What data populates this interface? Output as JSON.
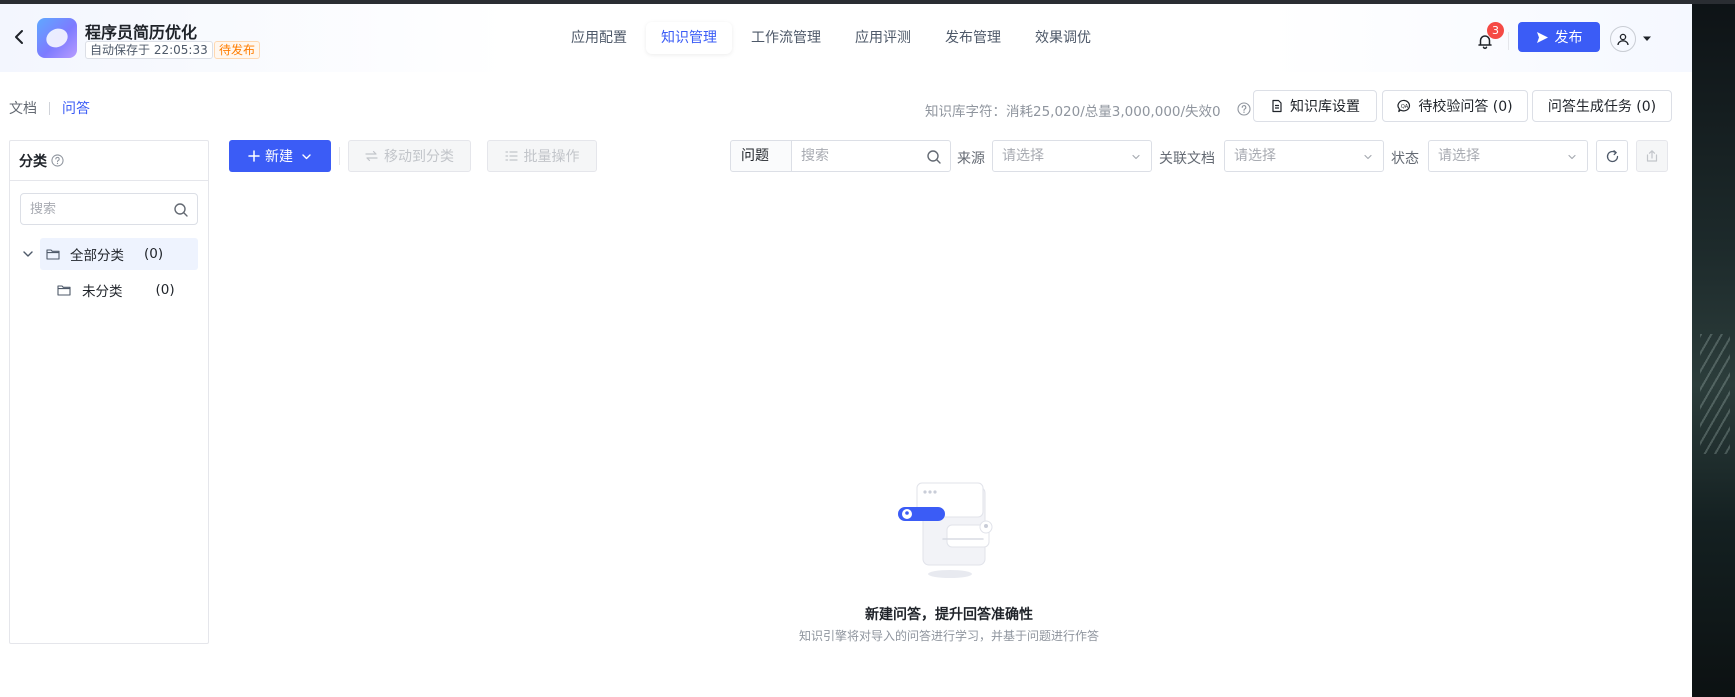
{
  "app": {
    "title": "程序员简历优化",
    "autosave": "自动保存于 22:05:33",
    "status": "待发布"
  },
  "nav": {
    "tabs": [
      {
        "label": "应用配置",
        "active": false
      },
      {
        "label": "知识管理",
        "active": true
      },
      {
        "label": "工作流管理",
        "active": false
      },
      {
        "label": "应用评测",
        "active": false
      },
      {
        "label": "发布管理",
        "active": false
      },
      {
        "label": "效果调优",
        "active": false
      }
    ]
  },
  "header": {
    "notification_count": "3",
    "publish_label": "发布"
  },
  "subtabs": {
    "docs": "文档",
    "qa": "问答"
  },
  "quota": {
    "text": "知识库字符：消耗25,020/总量3,000,000/失效0"
  },
  "actions": {
    "kb_settings": "知识库设置",
    "pending_verify": "待校验问答 (0)",
    "qa_generate": "问答生成任务 (0)"
  },
  "category_panel": {
    "title": "分类",
    "search_placeholder": "搜索",
    "tree": {
      "root": {
        "label": "全部分类",
        "count": "(0)"
      },
      "children": [
        {
          "label": "未分类",
          "count": "(0)"
        }
      ]
    }
  },
  "toolbar": {
    "new_label": "新建",
    "move_label": "移动到分类",
    "batch_label": "批量操作",
    "query_field": "问题",
    "search_placeholder": "搜索",
    "filters": [
      {
        "label": "来源",
        "placeholder": "请选择"
      },
      {
        "label": "关联文档",
        "placeholder": "请选择"
      },
      {
        "label": "状态",
        "placeholder": "请选择"
      }
    ]
  },
  "empty_state": {
    "title": "新建问答，提升回答准确性",
    "description": "知识引擎将对导入的问答进行学习，并基于问题进行作答"
  },
  "colors": {
    "primary": "#3b5cf6",
    "warning": "#ff7d00",
    "badge": "#f54a45"
  }
}
